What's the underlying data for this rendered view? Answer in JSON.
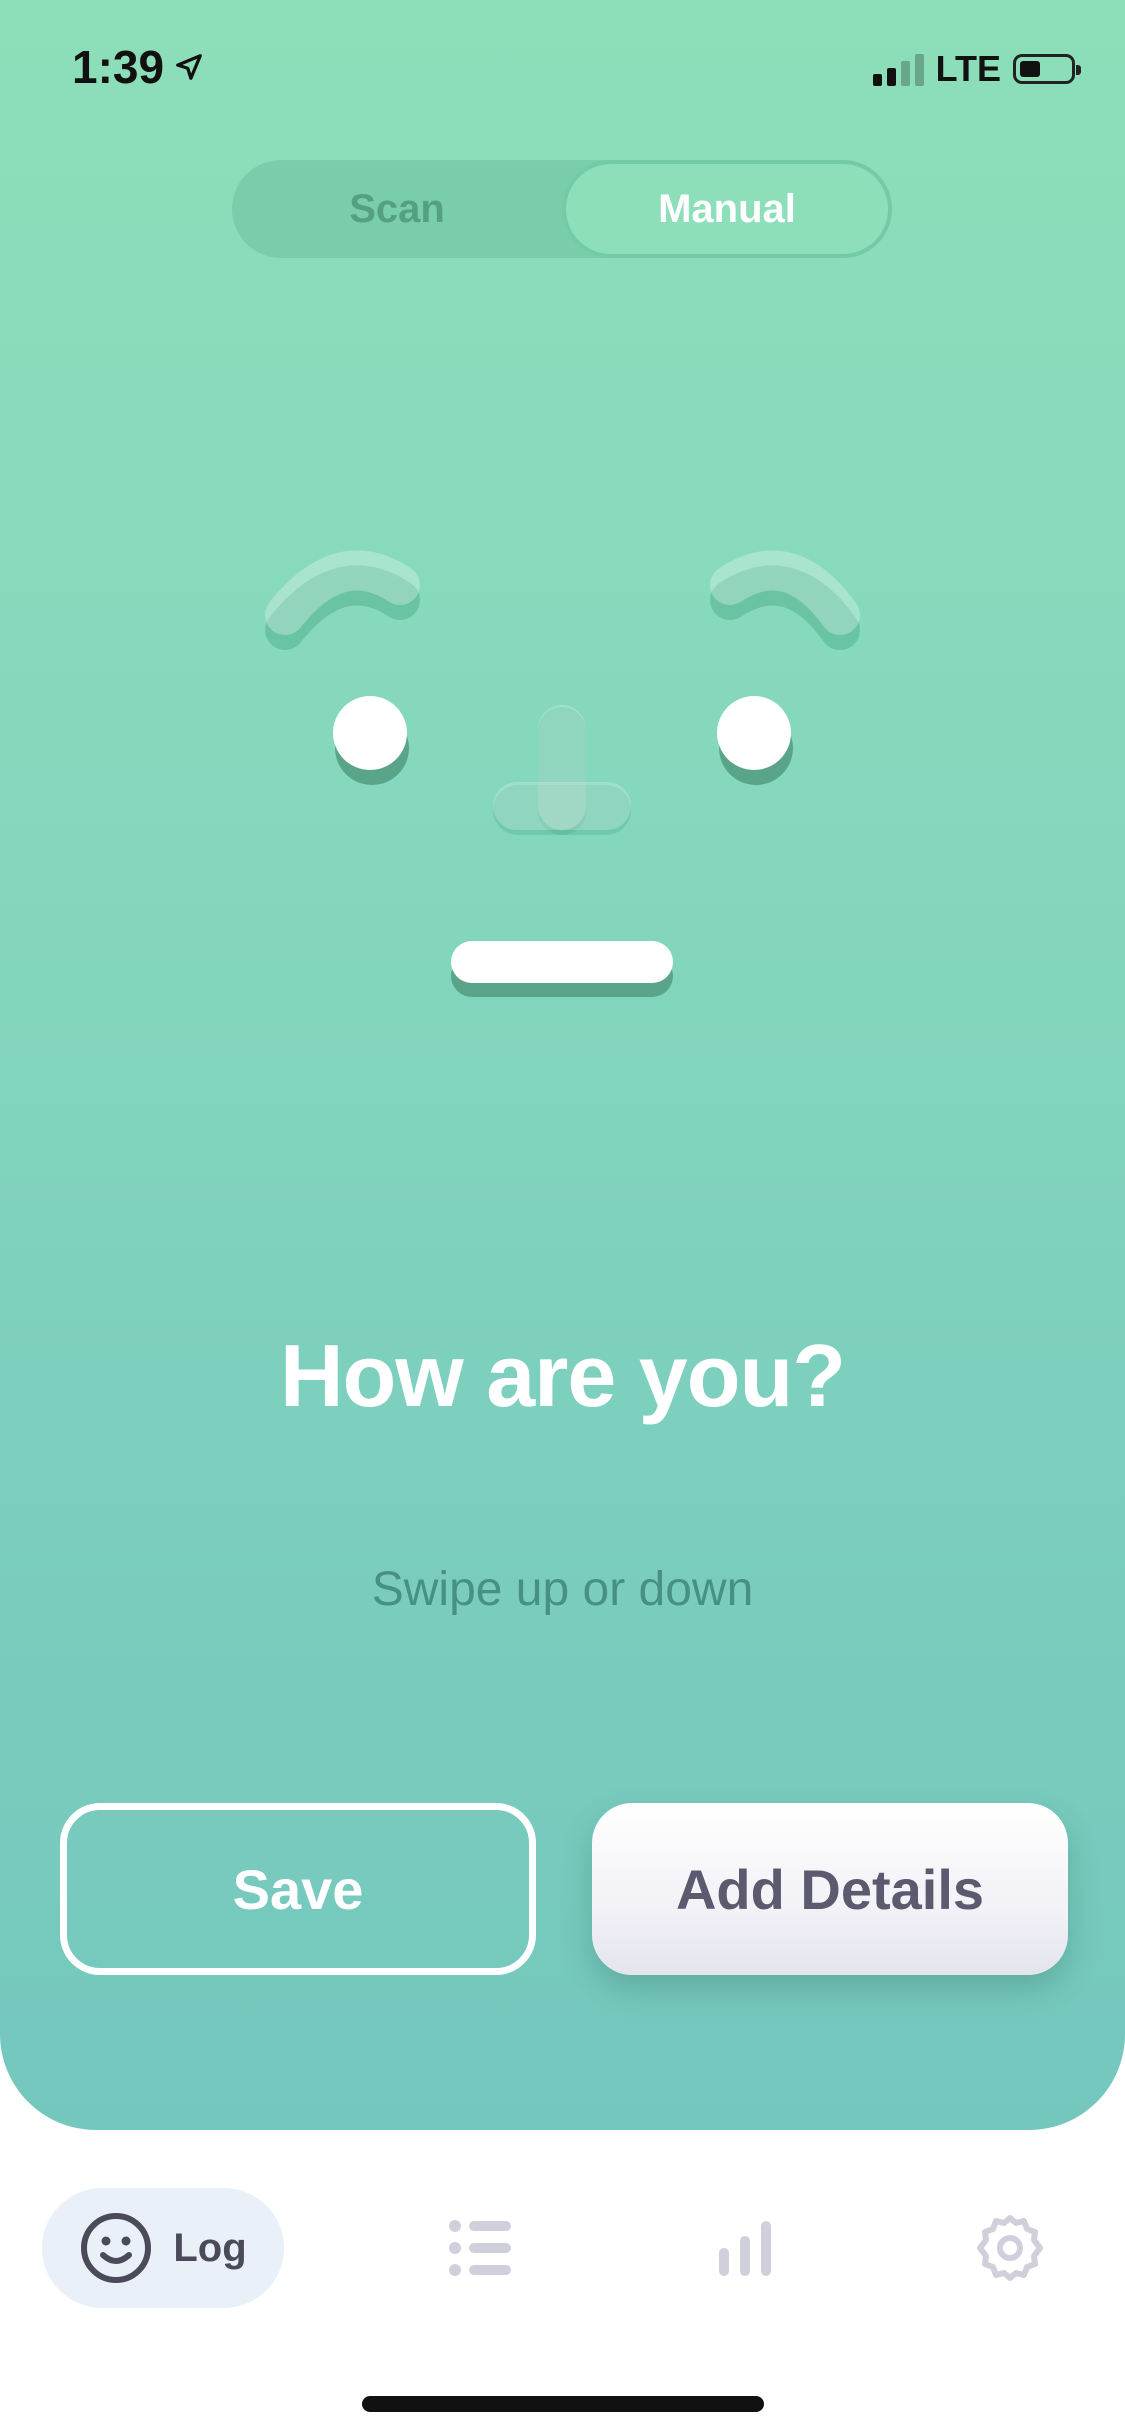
{
  "status_bar": {
    "time": "1:39",
    "network": "LTE"
  },
  "mode_toggle": {
    "scan_label": "Scan",
    "manual_label": "Manual",
    "selected": "Manual"
  },
  "main": {
    "title": "How are you?",
    "hint": "Swipe up or down"
  },
  "buttons": {
    "save_label": "Save",
    "add_details_label": "Add Details"
  },
  "tab_bar": {
    "log_label": "Log",
    "active": "Log"
  },
  "colors": {
    "hero_top": "#8ddfb9",
    "hero_bottom": "#74c7bd",
    "button_text_dark": "#5b5a6e",
    "tab_active_bg": "#eaf0f7",
    "tab_inactive_icon": "#cfd0dc"
  },
  "icons": [
    "location-arrow-icon",
    "signal-icon",
    "battery-icon",
    "smiley-icon",
    "list-icon",
    "bar-chart-icon",
    "gear-icon"
  ]
}
